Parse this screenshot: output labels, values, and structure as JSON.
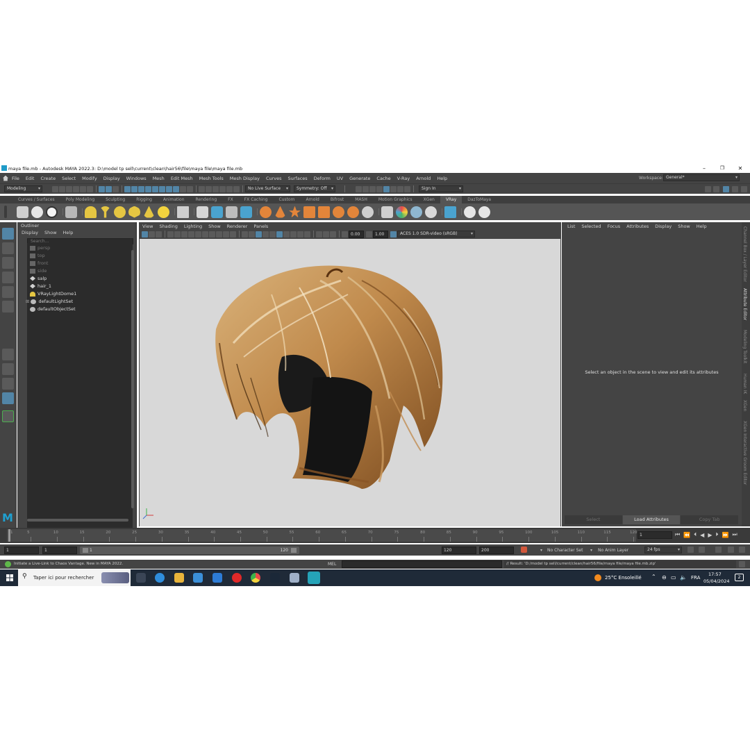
{
  "window": {
    "title": "maya file.mb - Autodesk MAYA 2022.3: D:\\model tp sell\\current\\clean\\hair56\\file\\maya file\\maya file.mb",
    "minimize": "–",
    "restore": "❐",
    "close": "✕"
  },
  "menubar": {
    "items": [
      "File",
      "Edit",
      "Create",
      "Select",
      "Modify",
      "Display",
      "Windows",
      "Mesh",
      "Edit Mesh",
      "Mesh Tools",
      "Mesh Display",
      "Curves",
      "Surfaces",
      "Deform",
      "UV",
      "Generate",
      "Cache",
      "V-Ray",
      "Arnold",
      "Help"
    ],
    "workspace_label": "Workspace:",
    "workspace_value": "General*"
  },
  "statusline": {
    "mode": "Modeling",
    "live_surface": "No Live Surface",
    "symmetry": "Symmetry: Off",
    "sign_in": "Sign In"
  },
  "shelf": {
    "tabs": [
      "Curves / Surfaces",
      "Poly Modeling",
      "Sculpting",
      "Rigging",
      "Animation",
      "Rendering",
      "FX",
      "FX Caching",
      "Custom",
      "Arnold",
      "Bifrost",
      "MASH",
      "Motion Graphics",
      "XGen",
      "VRay",
      "DazToMaya"
    ],
    "active_tab": "VRay"
  },
  "outliner": {
    "title": "Outliner",
    "menu": [
      "Display",
      "Show",
      "Help"
    ],
    "search_placeholder": "Search...",
    "items": [
      {
        "label": "persp",
        "dim": true,
        "icon": "camera-icon"
      },
      {
        "label": "top",
        "dim": true,
        "icon": "camera-icon"
      },
      {
        "label": "front",
        "dim": true,
        "icon": "camera-icon"
      },
      {
        "label": "side",
        "dim": true,
        "icon": "camera-icon"
      },
      {
        "label": "salp",
        "dim": false,
        "icon": "transform-icon"
      },
      {
        "label": "hair_1",
        "dim": false,
        "icon": "transform-icon"
      },
      {
        "label": "VRayLightDome1",
        "dim": false,
        "icon": "light-dome-icon"
      },
      {
        "label": "defaultLightSet",
        "dim": false,
        "icon": "set-icon"
      },
      {
        "label": "defaultObjectSet",
        "dim": false,
        "icon": "set-icon"
      }
    ]
  },
  "viewport": {
    "menu": [
      "View",
      "Shading",
      "Lighting",
      "Show",
      "Renderer",
      "Panels"
    ],
    "exposure": "0.00",
    "gamma": "1.00",
    "color_space": "ACES 1.0 SDR-video (sRGB)"
  },
  "attribute_editor": {
    "menu": [
      "List",
      "Selected",
      "Focus",
      "Attributes",
      "Display",
      "Show",
      "Help"
    ],
    "message": "Select an object in the scene to view and edit its attributes",
    "buttons": [
      "Select",
      "Load Attributes",
      "Copy Tab"
    ]
  },
  "side_tabs": [
    "Channel Box / Layer Editor",
    "Attribute Editor",
    "Modeling Toolkit",
    "Human IK",
    "XGen",
    "XGen Interactive Groom Editor"
  ],
  "timeline": {
    "ticks": [
      "5",
      "10",
      "15",
      "20",
      "25",
      "30",
      "35",
      "40",
      "45",
      "50",
      "55",
      "60",
      "65",
      "70",
      "75",
      "80",
      "85",
      "90",
      "95",
      "100",
      "105",
      "110",
      "115",
      "120"
    ],
    "first_tick": "1",
    "current_frame": "1"
  },
  "range": {
    "start": "1",
    "playback_start": "1",
    "slider_start": "1",
    "slider_end": "120",
    "playback_end": "120",
    "end": "200",
    "character_set": "No Character Set",
    "anim_layer": "No Anim Layer",
    "fps": "24 fps"
  },
  "command_line": {
    "help": "Initiate a Live-Link to Chaos Vantage. New in MAYA 2022.",
    "language": "MEL",
    "result": "// Result: 'D:/model tp sell/current/clean/hair56/file/maya file/maya file.mb.zip'"
  },
  "taskbar": {
    "search_placeholder": "Taper ici pour rechercher",
    "weather": "25°C  Ensoleillé",
    "language": "FRA",
    "time": "17:57",
    "date": "05/04/2024",
    "notifications": "2"
  },
  "colors": {
    "panel": "#444444",
    "dark_field": "#2b2b2b",
    "accent_blue": "#5285a6",
    "viewport_bg": "#d8d8d8",
    "hair_light": "#d6b07a",
    "hair_dark": "#6b3e16",
    "taskbar": "#1f2a38"
  }
}
